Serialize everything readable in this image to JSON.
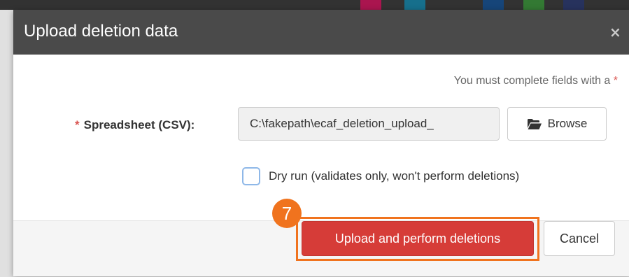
{
  "modal": {
    "title": "Upload deletion data",
    "close_icon": "×",
    "required_note": "You must complete fields with a",
    "required_star": "*",
    "field_label": "Spreadsheet (CSV):",
    "file_value": "C:\\fakepath\\ecaf_deletion_upload_",
    "browse_label": "Browse",
    "browse_icon": "folder-open-icon",
    "dry_run_label": "Dry run (validates only, won't perform deletions)",
    "dry_run_checked": false,
    "upload_label": "Upload and perform deletions",
    "cancel_label": "Cancel"
  },
  "annotation": {
    "step_number": "7"
  },
  "colors": {
    "header": "#4a4a4a",
    "danger": "#d63c38",
    "highlight": "#f0731e",
    "required": "#d9534f"
  }
}
